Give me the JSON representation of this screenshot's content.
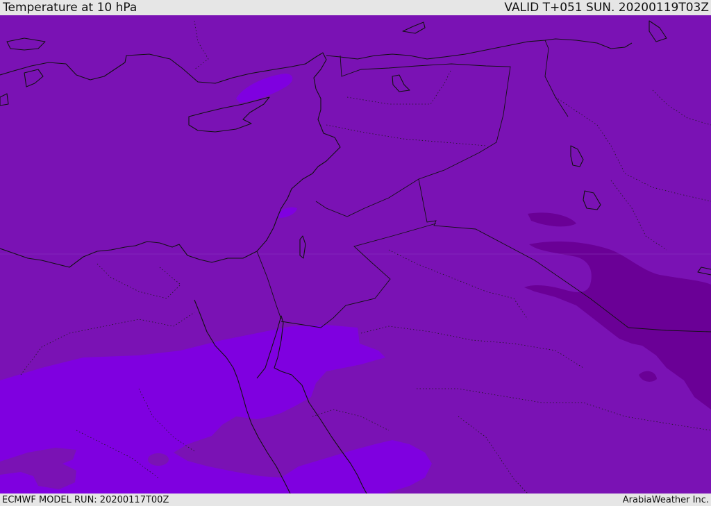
{
  "header": {
    "title": "Temperature at 10 hPa",
    "valid_time": "VALID T+051 SUN. 20200119T03Z"
  },
  "footer": {
    "model_run": "ECMWF MODEL RUN: 20200117T00Z",
    "credit": "ArabiaWeather Inc."
  },
  "colors": {
    "background_fill": "#7a12b4",
    "warmer_band_fill": "#7f00e0",
    "colder_band_fill": "#6a0096",
    "coastline": "#111111",
    "chrome": "#e6e6e6"
  }
}
